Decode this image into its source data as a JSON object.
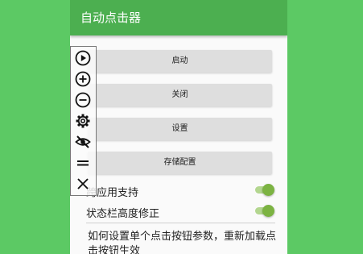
{
  "app": {
    "title": "自动点击器"
  },
  "buttons": {
    "start": "启动",
    "close": "关闭",
    "settings": "设置",
    "save_config": "存储配置"
  },
  "toggles": [
    {
      "label": "跨应用支持",
      "checked": true
    },
    {
      "label": "状态栏高度修正",
      "checked": true
    }
  ],
  "help_text": "如何设置单个点击按钮参数，重新加载点击按钮生效",
  "toolbar": {
    "icons": [
      "play-circle-icon",
      "add-circle-icon",
      "remove-circle-icon",
      "gear-icon",
      "eye-off-icon",
      "drag-handle-icon",
      "close-icon"
    ]
  },
  "colors": {
    "accent": "#4caf50",
    "background": "#5cc964",
    "switch_on": "#7cb342"
  }
}
